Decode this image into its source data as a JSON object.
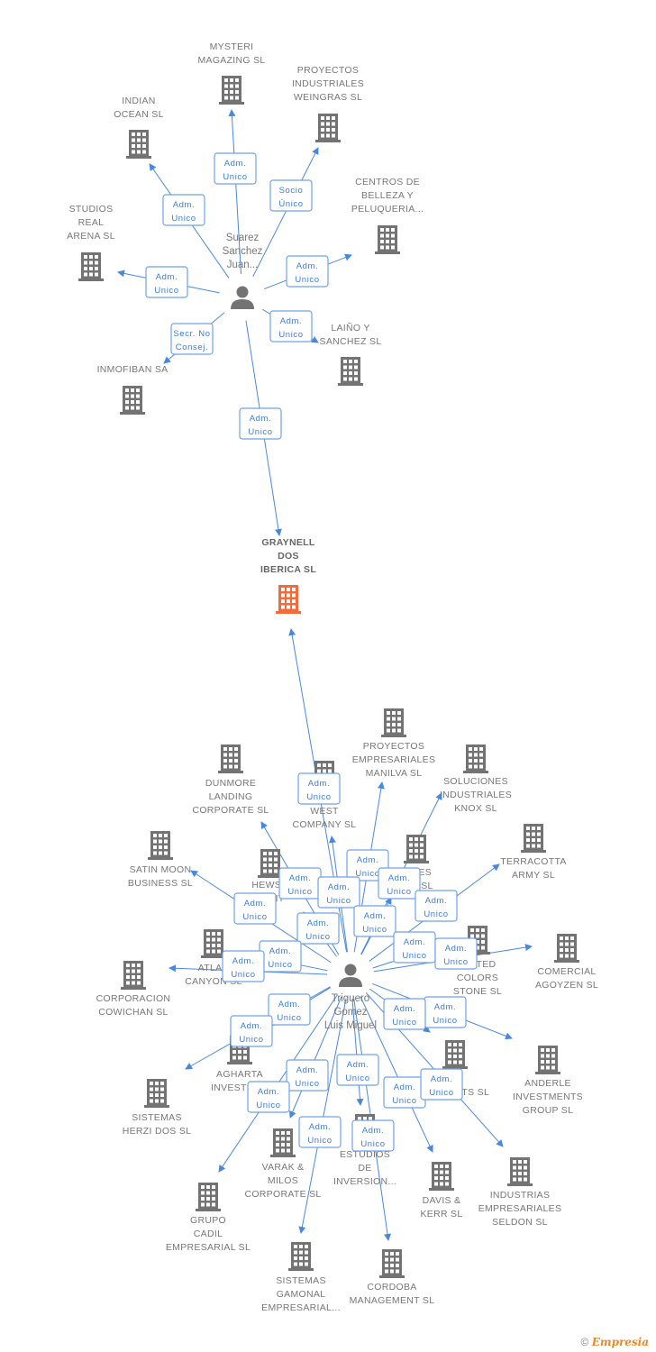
{
  "colors": {
    "edge": "#4a88dc",
    "node": "#737373",
    "focus": "#f26b3a",
    "role_text": "#3b7dd8"
  },
  "people": [
    {
      "lines": [
        "Suarez",
        "Sanchez",
        "Juan..."
      ]
    },
    {
      "lines": [
        "Triguero",
        "Gomez",
        "Luis Miguel"
      ]
    }
  ],
  "companies": [
    {
      "lines": [
        "MYSTERI",
        "MAGAZING SL"
      ]
    },
    {
      "lines": [
        "PROYECTOS",
        "INDUSTRIALES",
        "WEINGRAS SL"
      ]
    },
    {
      "lines": [
        "INDIAN",
        "OCEAN SL"
      ]
    },
    {
      "lines": [
        "CENTROS DE",
        "BELLEZA Y",
        "PELUQUERIA..."
      ]
    },
    {
      "lines": [
        "STUDIOS",
        "REAL",
        "ARENA SL"
      ]
    },
    {
      "lines": [
        "LAIÑO Y",
        "SANCHEZ SL"
      ]
    },
    {
      "lines": [
        "INMOFIBAN SA"
      ]
    },
    {
      "lines": [
        "GRAYNELL",
        "DOS",
        "IBERICA SL"
      ],
      "focus": true
    },
    {
      "lines": [
        "PROYECTOS",
        "EMPRESARIALES",
        "MANILVA SL"
      ]
    },
    {
      "lines": [
        "SOLUCIONES",
        "INDUSTRIALES",
        "KNOX SL"
      ]
    },
    {
      "lines": [
        "DUNMORE",
        "LANDING",
        "CORPORATE SL"
      ]
    },
    {
      "lines": [
        "",
        "WEST",
        "COMPANY SL"
      ]
    },
    {
      "lines": [
        "TERRACOTTA",
        "ARMY  SL"
      ]
    },
    {
      "lines": [
        "SATIN MOON",
        "BUSINESS SL"
      ]
    },
    {
      "lines": [
        "HEWSO",
        "MENT"
      ]
    },
    {
      "lines": [
        "IONES",
        "N III SL"
      ]
    },
    {
      "lines": [
        "ATLAN",
        "CANYON SL"
      ]
    },
    {
      "lines": [
        "CORPORACION",
        "COWICHAN SL"
      ]
    },
    {
      "lines": [
        "UNITED",
        "COLORS",
        "STONE SL"
      ]
    },
    {
      "lines": [
        "COMERCIAL",
        "AGOYZEN SL"
      ]
    },
    {
      "lines": [
        "AGHARTA",
        "INVESTMEN"
      ]
    },
    {
      "lines": [
        "NO",
        "ESTMENTS SL"
      ]
    },
    {
      "lines": [
        "ANDERLE",
        "INVESTMENTS",
        "GROUP SL"
      ]
    },
    {
      "lines": [
        "SISTEMAS",
        "HERZI DOS SL"
      ]
    },
    {
      "lines": [
        "VARAK &",
        "MILOS",
        "CORPORATE SL"
      ]
    },
    {
      "lines": [
        "ESTUDIOS",
        "DE",
        "INVERSION..."
      ]
    },
    {
      "lines": [
        "DAVIS &",
        "KERR SL"
      ]
    },
    {
      "lines": [
        "INDUSTRIAS",
        "EMPRESARIALES",
        "SELDON SL"
      ]
    },
    {
      "lines": [
        "GRUPO",
        "CADIL",
        "EMPRESARIAL SL"
      ]
    },
    {
      "lines": [
        "SISTEMAS",
        "GAMONAL",
        "EMPRESARIAL..."
      ]
    },
    {
      "lines": [
        "CORDOBA",
        "MANAGEMENT SL"
      ]
    }
  ],
  "edges": [
    {
      "from": 0,
      "to": 0,
      "role": [
        "Adm.",
        "Unico"
      ]
    },
    {
      "from": 0,
      "to": 1,
      "role": [
        "Socio",
        "Único"
      ]
    },
    {
      "from": 0,
      "to": 2,
      "role": [
        "Adm.",
        "Unico"
      ]
    },
    {
      "from": 0,
      "to": 3,
      "role": [
        "Adm.",
        "Unico"
      ]
    },
    {
      "from": 0,
      "to": 4,
      "role": [
        "Adm.",
        "Unico"
      ]
    },
    {
      "from": 0,
      "to": 5,
      "role": [
        "Adm.",
        "Unico"
      ]
    },
    {
      "from": 0,
      "to": 6,
      "role": [
        "Secr. No",
        "Consej."
      ]
    },
    {
      "from": 0,
      "to": 7,
      "role": [
        "Adm.",
        "Unico"
      ]
    },
    {
      "from": 1,
      "to": 7,
      "role": [
        "Adm.",
        "Unico"
      ]
    },
    {
      "from": 1,
      "to": 8,
      "role": [
        "Adm.",
        "Unico"
      ]
    },
    {
      "from": 1,
      "to": 9,
      "role": [
        "Adm.",
        "Unico"
      ]
    },
    {
      "from": 1,
      "to": 10,
      "role": [
        "Adm.",
        "Unico"
      ]
    },
    {
      "from": 1,
      "to": 11,
      "role": [
        "Adm.",
        "Unico"
      ]
    },
    {
      "from": 1,
      "to": 12,
      "role": [
        "Adm.",
        "Unico"
      ]
    },
    {
      "from": 1,
      "to": 13,
      "role": [
        "Adm.",
        "Unico"
      ]
    },
    {
      "from": 1,
      "to": 14,
      "role": [
        "Adm.",
        "Unico"
      ]
    },
    {
      "from": 1,
      "to": 15,
      "role": [
        "Adm.",
        "Unico"
      ]
    },
    {
      "from": 1,
      "to": 16,
      "role": [
        "Adm.",
        "Unico"
      ]
    },
    {
      "from": 1,
      "to": 17,
      "role": [
        "Adm.",
        "Unico"
      ]
    },
    {
      "from": 1,
      "to": 18,
      "role": [
        "Adm.",
        "Unico"
      ]
    },
    {
      "from": 1,
      "to": 19,
      "role": [
        "Adm.",
        "Unico"
      ]
    },
    {
      "from": 1,
      "to": 20,
      "role": [
        "Adm.",
        "Unico"
      ]
    },
    {
      "from": 1,
      "to": 23,
      "role": [
        "Adm.",
        "Unico"
      ]
    },
    {
      "from": 1,
      "to": 21,
      "role": [
        "Adm.",
        "Unico"
      ]
    },
    {
      "from": 1,
      "to": 22,
      "role": [
        "Adm.",
        "Unico"
      ]
    },
    {
      "from": 1,
      "to": 24,
      "role": [
        "Adm.",
        "Unico"
      ]
    },
    {
      "from": 1,
      "to": 25,
      "role": [
        "Adm.",
        "Unico"
      ]
    },
    {
      "from": 1,
      "to": 28,
      "role": [
        "Adm.",
        "Unico"
      ]
    },
    {
      "from": 1,
      "to": 26,
      "role": [
        "Adm.",
        "Unico"
      ]
    },
    {
      "from": 1,
      "to": 27,
      "role": [
        "Adm.",
        "Unico"
      ]
    },
    {
      "from": 1,
      "to": 29,
      "role": [
        "Adm.",
        "Unico"
      ]
    },
    {
      "from": 1,
      "to": 30,
      "role": [
        "Adm.",
        "Unico"
      ]
    }
  ],
  "footer": {
    "copyright": "©",
    "brand": "Empresia"
  }
}
